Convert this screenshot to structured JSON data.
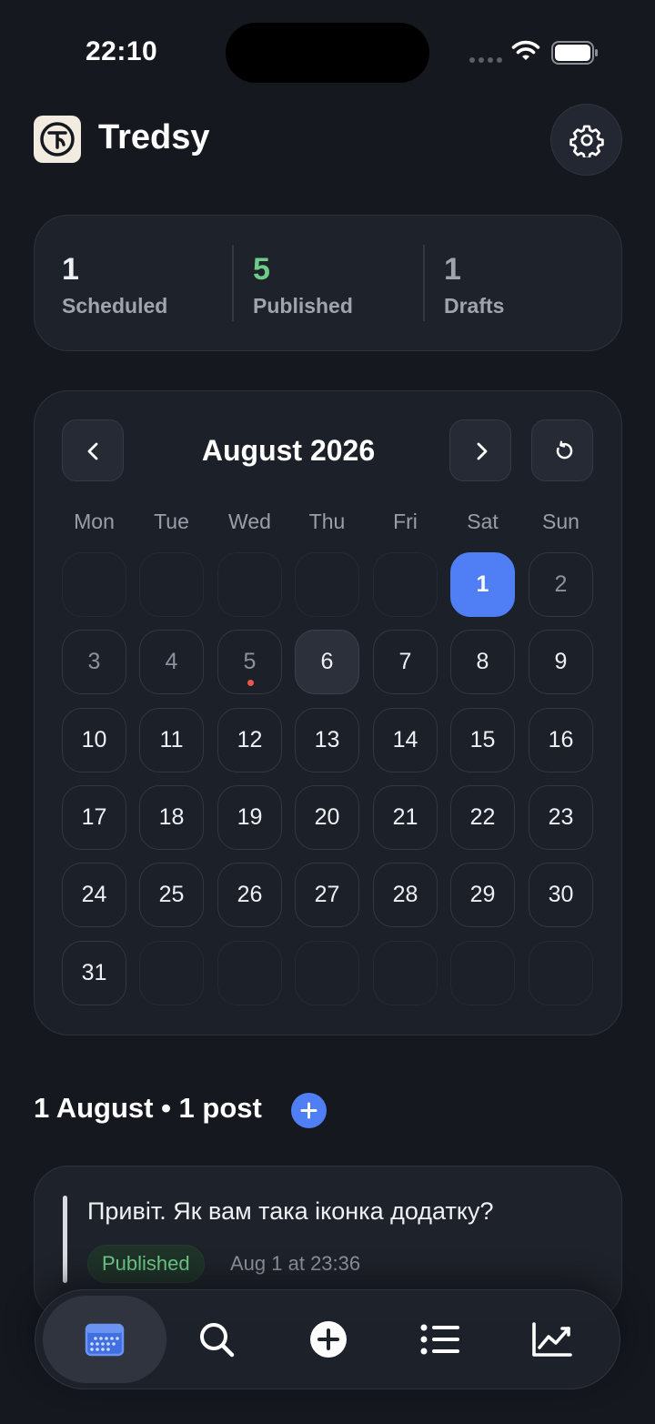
{
  "status_bar": {
    "time": "22:10"
  },
  "header": {
    "app_name": "Tredsy",
    "logo_letter": "T",
    "settings_icon": "gear-icon"
  },
  "stats": [
    {
      "value": "1",
      "label": "Scheduled",
      "color": "#eef0f4"
    },
    {
      "value": "5",
      "label": "Published",
      "color": "#6fcb89"
    },
    {
      "value": "1",
      "label": "Drafts",
      "color": "#a0a4ad"
    }
  ],
  "calendar": {
    "month_title": "August 2026",
    "weekdays": [
      "Mon",
      "Tue",
      "Wed",
      "Thu",
      "Fri",
      "Sat",
      "Sun"
    ],
    "days": [
      "",
      "",
      "",
      "",
      "",
      "1",
      "2",
      "3",
      "4",
      "5",
      "6",
      "7",
      "8",
      "9",
      "10",
      "11",
      "12",
      "13",
      "14",
      "15",
      "16",
      "17",
      "18",
      "19",
      "20",
      "21",
      "22",
      "23",
      "24",
      "25",
      "26",
      "27",
      "28",
      "29",
      "30",
      "31",
      "",
      "",
      "",
      "",
      "",
      ""
    ],
    "selected_day": "1",
    "today_day": "6",
    "days_with_posts": [
      "5"
    ],
    "accent_color": "#4f7ef5"
  },
  "section": {
    "title": "1 August • 1 post"
  },
  "post": {
    "text": "Привіт. Як вам така іконка додатку?",
    "status": "Published",
    "time": "Aug 1 at 23:36"
  },
  "tab_bar": {
    "items": [
      {
        "name": "calendar-icon",
        "active": true
      },
      {
        "name": "search-icon",
        "active": false
      },
      {
        "name": "add-circle-icon",
        "active": false
      },
      {
        "name": "list-icon",
        "active": false
      },
      {
        "name": "chart-icon",
        "active": false
      }
    ]
  }
}
